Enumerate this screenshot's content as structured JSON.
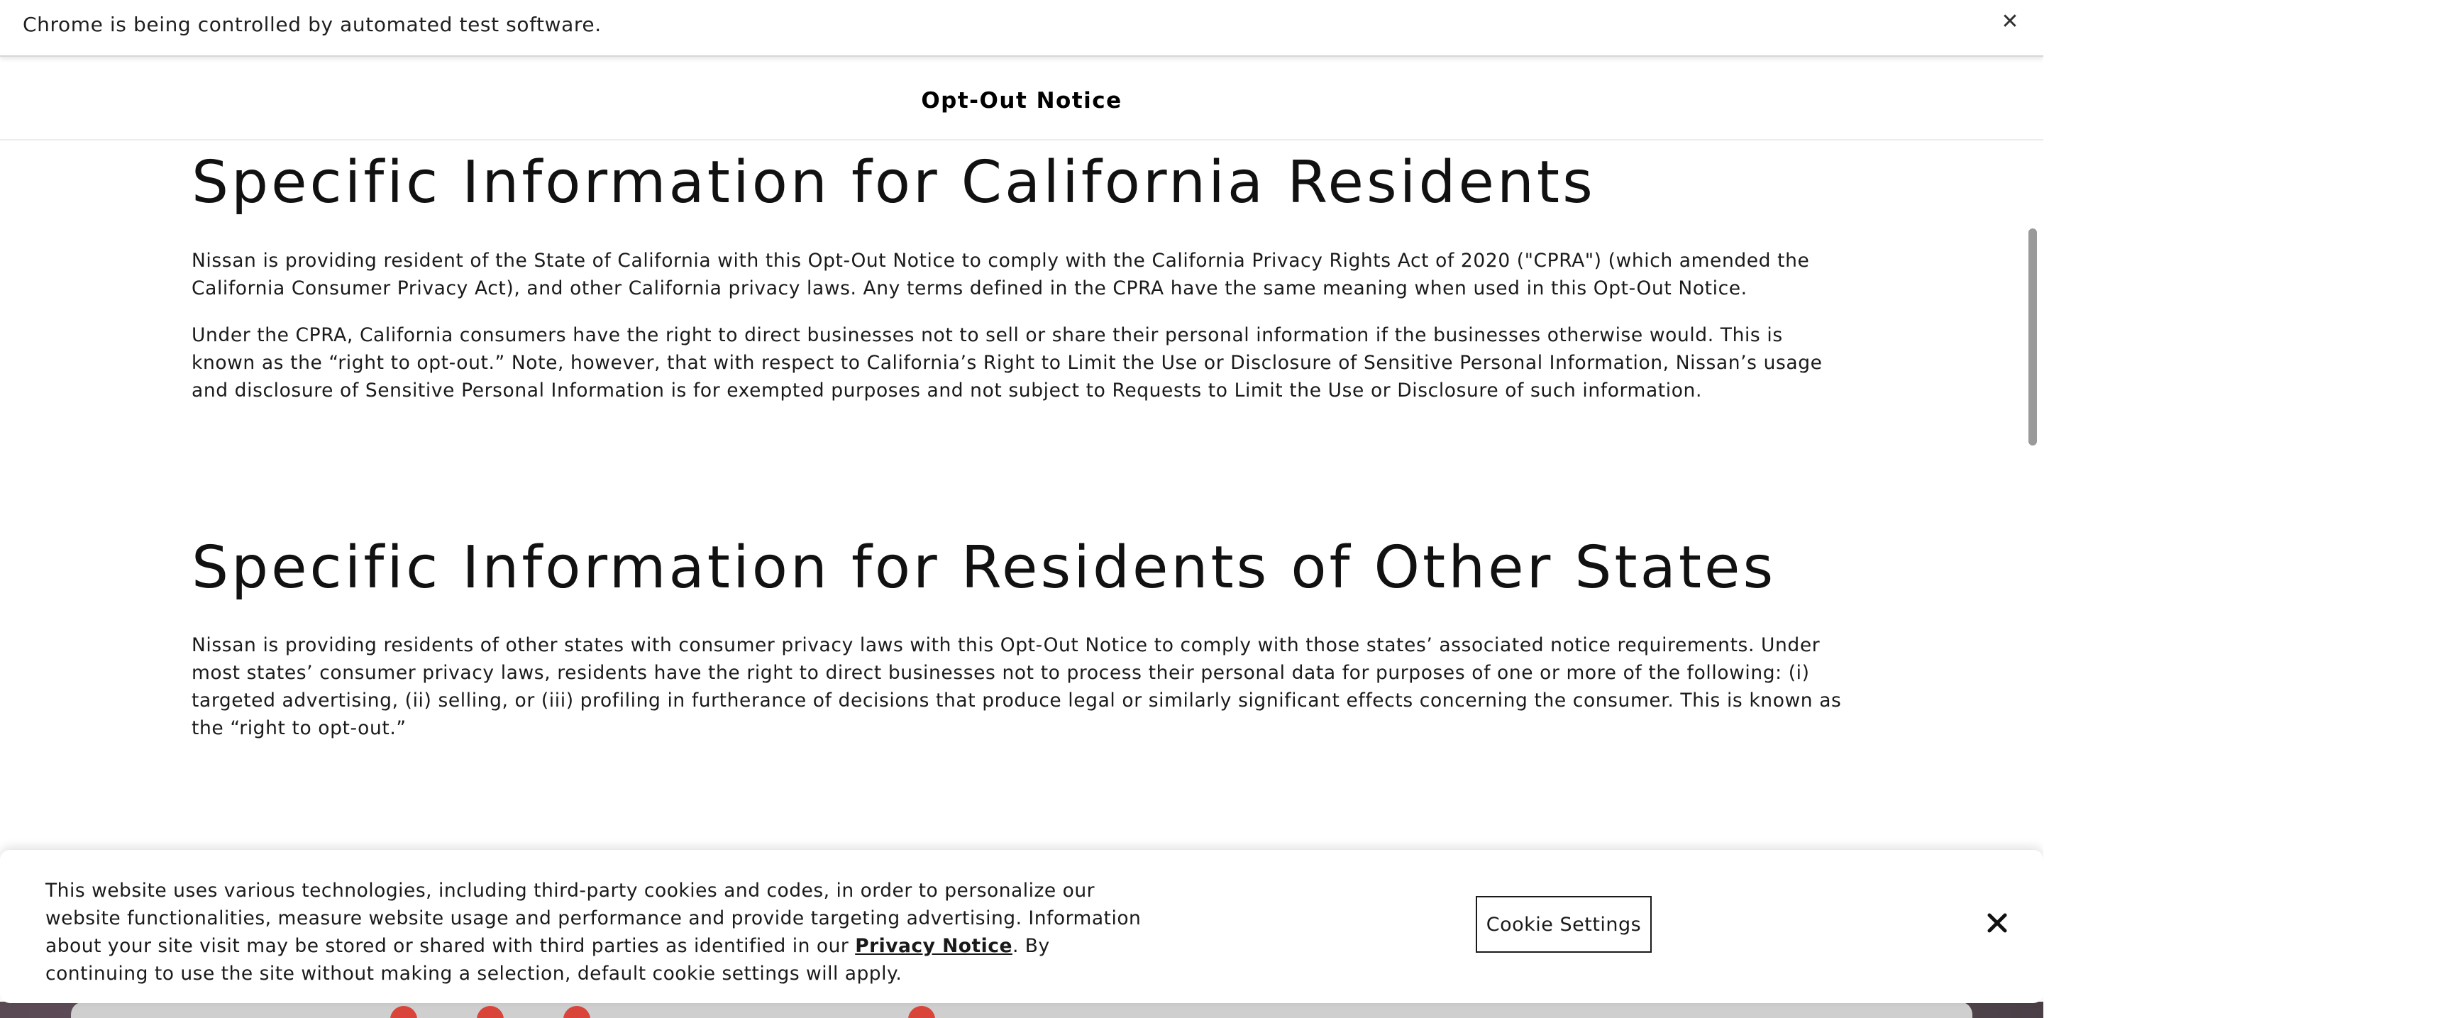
{
  "infobar": {
    "text": "Chrome is being controlled by automated test software.",
    "close_glyph": "✕",
    "close_icon": "close-icon"
  },
  "header": {
    "title": "Opt-Out Notice"
  },
  "sections": [
    {
      "heading": "Specific Information for California Residents",
      "paragraphs": [
        "Nissan is providing resident of the State of California with this Opt-Out Notice to comply with the California Privacy Rights Act of 2020 (\"CPRA\") (which amended the California Consumer Privacy Act), and other California privacy laws. Any terms defined in the CPRA have the same meaning when used in this Opt-Out Notice.",
        "Under the CPRA, California consumers have the right to direct businesses not to sell or share their personal information if the businesses otherwise would. This is known as the “right to opt-out.” Note, however, that with respect to California’s Right to Limit the Use or Disclosure of Sensitive Personal Information, Nissan’s usage and disclosure of Sensitive Personal Information is for exempted purposes and not subject to Requests to Limit the Use or Disclosure of such information."
      ]
    },
    {
      "heading": "Specific Information for Residents of Other States",
      "paragraphs": [
        "Nissan is providing residents of other states with consumer privacy laws with this Opt-Out Notice to comply with those states’ associated notice requirements. Under most states’ consumer privacy laws, residents have the right to direct businesses not to process their personal data for purposes of one or more of the following: (i) targeted advertising, (ii) selling, or (iii) profiling in furtherance of decisions that produce legal or similarly significant effects concerning the consumer. This is known as the “right to opt-out.”"
      ]
    }
  ],
  "cookie_banner": {
    "text_before_link": "This website uses various technologies, including third-party cookies and codes, in order to personalize our website functionalities, measure website usage and performance and provide targeting advertising. Information about your site visit may be stored or shared with third parties as identified in our ",
    "link_label": "Privacy Notice",
    "text_after_link": ". By continuing to use the site without making a selection, default cookie settings will apply.",
    "settings_button_label": "Cookie Settings",
    "close_icon": "close-icon"
  },
  "colors": {
    "text": "#1a1a1a",
    "scrollbar_thumb": "#9a9a9a",
    "banner_background": "#ffffff"
  }
}
